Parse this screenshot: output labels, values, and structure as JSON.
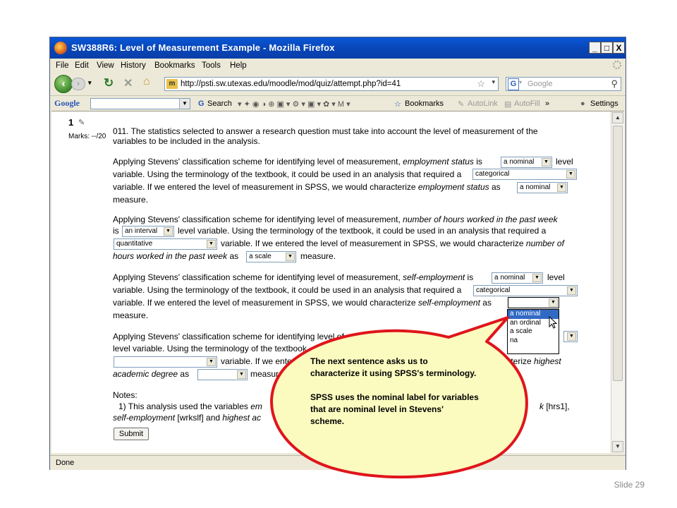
{
  "window": {
    "title": "SW388R6: Level of Measurement Example - Mozilla Firefox",
    "buttons": [
      "_",
      "□",
      "X"
    ]
  },
  "menu": [
    "File",
    "Edit",
    "View",
    "History",
    "Bookmarks",
    "Tools",
    "Help"
  ],
  "nav": {
    "url": "http://psti.sw.utexas.edu/moodle/mod/quiz/attempt.php?id=41",
    "search_placeholder": "Google"
  },
  "google_toolbar": {
    "logo": "Google",
    "search": "Search",
    "bookmarks": "Bookmarks",
    "autolink": "AutoLink",
    "autofill": "AutoFill",
    "more": "»",
    "settings": "Settings"
  },
  "question": {
    "number": "1",
    "marks": "Marks: --/20",
    "intro_1": "011. The statistics selected to answer a research question must take into account the level of measurement of the",
    "intro_2": "variables to be included in the analysis.",
    "p1": {
      "a": "Applying Stevens' classification scheme for identifying level of measurement,",
      "var": "employment status",
      "b": "is",
      "sel1": "a nominal",
      "c": "level",
      "d": "variable. Using the terminology of the textbook, it could be used in an analysis that required a",
      "sel2": "categorical",
      "e": "variable. If we entered the level of measurement in SPSS, we would characterize",
      "var2": "employment status",
      "f": "as",
      "sel3": "a nominal",
      "g": "measure."
    },
    "p2": {
      "a": "Applying Stevens' classification scheme for identifying level of measurement,",
      "var": "number of hours worked in the past week",
      "is": "is",
      "sel1": "an interval",
      "b": "level variable. Using the terminology of the textbook, it could be used in an analysis that required a",
      "sel2": "quantitative",
      "c": "variable. If we entered the level of measurement in SPSS, we would characterize",
      "var2": "number of",
      "var3": "hours worked in the past week",
      "d": "as",
      "sel3": "a scale",
      "e": "measure."
    },
    "p3": {
      "a": "Applying Stevens' classification scheme for identifying level of measurement,",
      "var": "self-employment",
      "b": "is",
      "sel1": "a nominal",
      "c": "level",
      "d": "variable. Using the terminology of the textbook, it could be used in an analysis that required a",
      "sel2": "categorical",
      "e": "variable. If we entered the level of measurement in SPSS, we would characterize",
      "var2": "self-employment",
      "f": "as",
      "g": "measure.",
      "options": [
        "a nominal",
        "an ordinal",
        "a scale",
        "na"
      ]
    },
    "p4": {
      "a": "Applying Stevens' classification scheme for identifying level of m",
      "a_tail": "cademi",
      "b": "level variable. Using the terminology of the textbook",
      "c": "variable. If we enter",
      "c_tail": "aracterize",
      "var_tail": "highest",
      "var2": "academic degree",
      "d": "as",
      "e": "measur"
    },
    "notes": {
      "label": "Notes:",
      "line1": "1) This analysis used the variables",
      "line1_var": "em",
      "line1_tail": "k",
      "line1_end": "[hrs1],",
      "line2_var": "self-employment",
      "line2": "[wrkslf] and",
      "line2_var2": "highest ac"
    },
    "submit": "Submit"
  },
  "status": "Done",
  "callout": {
    "line1": "The next sentence asks us to characterize it using SPSS's terminology.",
    "line2": "SPSS uses the nominal label for variables that are nominal level in Stevens' scheme.",
    "fill": "#fbfbc0",
    "border": "#e0151b"
  },
  "slide": "Slide 29"
}
